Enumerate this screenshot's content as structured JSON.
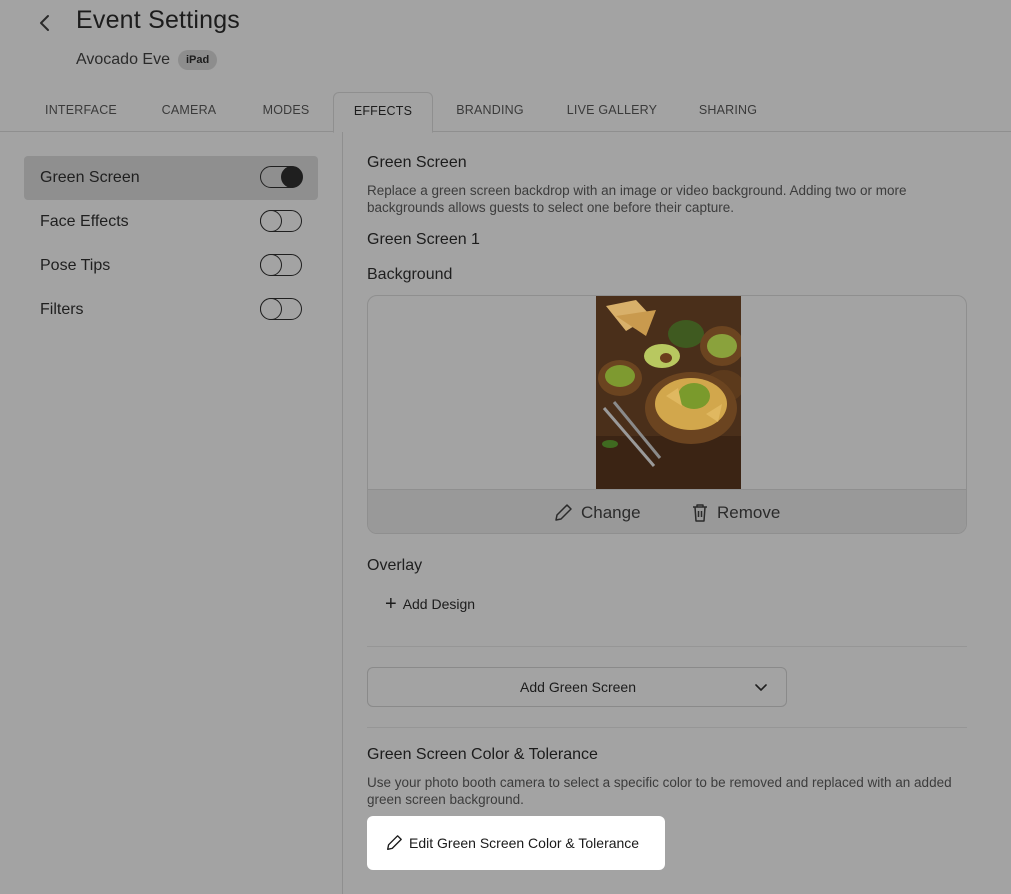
{
  "header": {
    "title": "Event Settings",
    "event_name": "Avocado Eve",
    "device_badge": "iPad"
  },
  "tabs": [
    {
      "label": "INTERFACE",
      "active": false
    },
    {
      "label": "CAMERA",
      "active": false
    },
    {
      "label": "MODES",
      "active": false
    },
    {
      "label": "EFFECTS",
      "active": true
    },
    {
      "label": "BRANDING",
      "active": false
    },
    {
      "label": "LIVE GALLERY",
      "active": false
    },
    {
      "label": "SHARING",
      "active": false
    }
  ],
  "sidebar": {
    "items": [
      {
        "label": "Green Screen",
        "enabled": true,
        "selected": true
      },
      {
        "label": "Face Effects",
        "enabled": false,
        "selected": false
      },
      {
        "label": "Pose Tips",
        "enabled": false,
        "selected": false
      },
      {
        "label": "Filters",
        "enabled": false,
        "selected": false
      }
    ]
  },
  "main": {
    "section_title": "Green Screen",
    "section_desc": "Replace a green screen backdrop with an image or video background. Adding two or more backgrounds allows guests to select one before their capture.",
    "item_title": "Green Screen 1",
    "background_label": "Background",
    "background_image_alt": "avocado and guacamole table",
    "change_label": "Change",
    "remove_label": "Remove",
    "overlay_label": "Overlay",
    "add_design_label": "Add Design",
    "add_green_screen_label": "Add Green Screen",
    "color_title": "Green Screen Color & Tolerance",
    "color_desc": "Use your photo booth camera to select a specific color to be removed and replaced with an added green screen background.",
    "edit_color_label": "Edit Green Screen Color & Tolerance"
  },
  "colors": {
    "overlay_bg": "#a3a3a3",
    "active_toggle": "#1f1f1f",
    "edit_button_bg": "#ffffff"
  }
}
